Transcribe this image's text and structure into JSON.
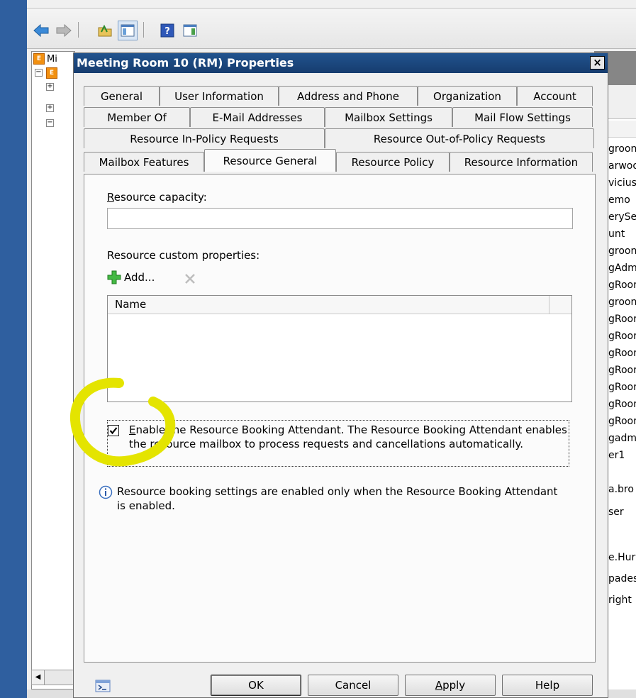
{
  "mmc": {
    "tree_root_label": "Mi",
    "right_pane_fragments": [
      "groon",
      "arwoo",
      "vicius",
      "emo",
      "erySe",
      "unt",
      "groon",
      "gAdm",
      "gRoor",
      "groon",
      "gRoor",
      "gRoor",
      "gRoor",
      "gRoor",
      "gRoor",
      "gRoor",
      "gRoor",
      "gadm",
      "er1",
      "a.bro",
      "ser",
      "e.Hur",
      "pades",
      "right"
    ]
  },
  "dialog": {
    "title": "Meeting Room 10 (RM) Properties",
    "close_label": "×",
    "tabs_row1": [
      "General",
      "User Information",
      "Address and Phone",
      "Organization",
      "Account"
    ],
    "tabs_row2": [
      "Member Of",
      "E-Mail Addresses",
      "Mailbox Settings",
      "Mail Flow Settings"
    ],
    "tabs_row3": [
      "Resource In-Policy Requests",
      "Resource Out-of-Policy Requests"
    ],
    "tabs_row4": [
      "Mailbox Features",
      "Resource General",
      "Resource Policy",
      "Resource Information"
    ],
    "active_tab": "Resource General",
    "resource_capacity": {
      "mnemonic": "R",
      "label_rest": "esource capacity:",
      "value": ""
    },
    "custom_properties": {
      "label": "Resource custom properties:",
      "add_label": "Add...",
      "columns": [
        "Name"
      ],
      "rows": []
    },
    "booking_attendant": {
      "checked": true,
      "mnemonic": "E",
      "label_rest": "nable the Resource Booking Attendant. The Resource Booking Attendant enables the resource mailbox to process requests and cancellations automatically."
    },
    "info_text": "Resource booking settings are enabled only when the Resource Booking Attendant is enabled.",
    "buttons": {
      "ok": "OK",
      "cancel": "Cancel",
      "apply_mnemonic": "A",
      "apply_rest": "pply",
      "help": "Help"
    }
  },
  "colors": {
    "titlebar": "#1b4a82",
    "highlight": "#e4e400",
    "mmc_strip": "#2f5f9f"
  }
}
